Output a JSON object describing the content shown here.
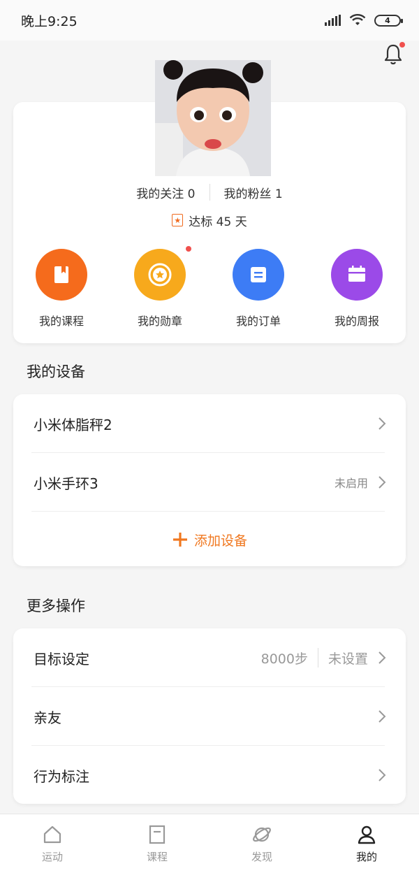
{
  "status_bar": {
    "time": "晚上9:25",
    "battery": "4"
  },
  "profile": {
    "following_label": "我的关注 0",
    "followers_label": "我的粉丝 1",
    "streak_label": "达标 45 天",
    "quick_actions": [
      {
        "label": "我的课程",
        "color": "#f56b1c",
        "icon": "course-icon"
      },
      {
        "label": "我的勋章",
        "color": "#f7a91c",
        "icon": "medal-icon"
      },
      {
        "label": "我的订单",
        "color": "#3d7cf5",
        "icon": "order-icon"
      },
      {
        "label": "我的周报",
        "color": "#9b4ae8",
        "icon": "report-icon"
      }
    ]
  },
  "devices": {
    "title": "我的设备",
    "items": [
      {
        "label": "小米体脂秤2",
        "status": ""
      },
      {
        "label": "小米手环3",
        "status": "未启用"
      }
    ],
    "add_label": "添加设备"
  },
  "more": {
    "title": "更多操作",
    "items": [
      {
        "label": "目标设定",
        "value": "8000步",
        "status": "未设置"
      },
      {
        "label": "亲友"
      },
      {
        "label": "行为标注"
      }
    ]
  },
  "tabbar": {
    "tabs": [
      {
        "label": "运动",
        "active": false
      },
      {
        "label": "课程",
        "active": false
      },
      {
        "label": "发现",
        "active": false
      },
      {
        "label": "我的",
        "active": true
      }
    ]
  }
}
